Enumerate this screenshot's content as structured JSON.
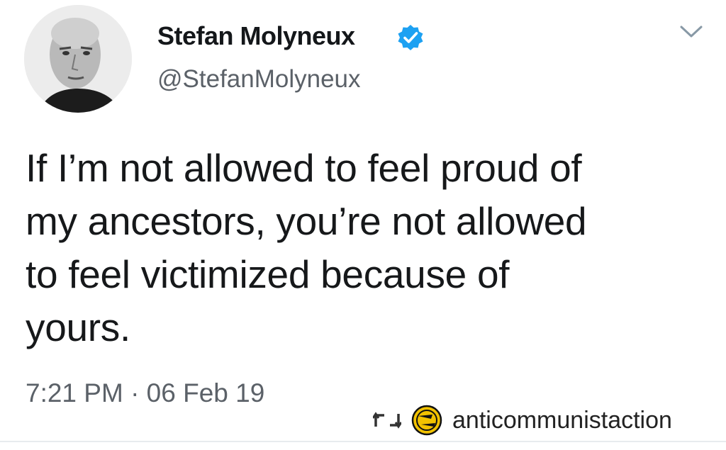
{
  "tweet": {
    "author": {
      "display_name": "Stefan Molyneux",
      "handle": "@StefanMolyneux",
      "verified": true,
      "verified_color": "#1da1f2"
    },
    "text_lines": [
      "If I’m not allowed to feel proud of",
      "my ancestors, you’re not allowed",
      "to feel victimized because of",
      "yours."
    ],
    "timestamp": "7:21 PM · 06 Feb 19",
    "menu_icon": "chevron-down-icon"
  },
  "repost_credit": {
    "icon": "repost-icon",
    "avatar_icon": "antifa-logo-icon",
    "avatar_color": "#f2c200",
    "username": "anticommunistaction"
  }
}
